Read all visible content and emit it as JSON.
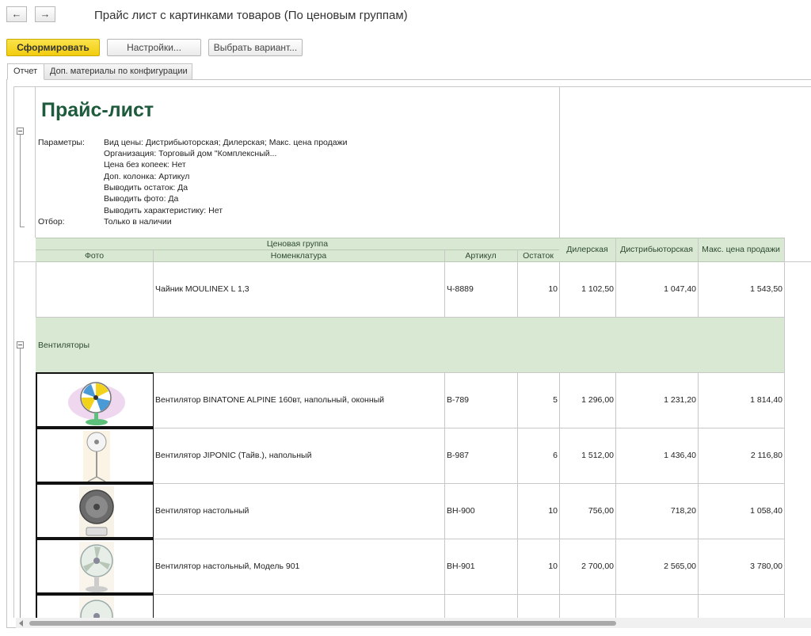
{
  "nav": {
    "back_icon": "←",
    "forward_icon": "→"
  },
  "window": {
    "title": "Прайс лист с картинками товаров (По ценовым группам)"
  },
  "toolbar": {
    "generate_label": "Сформировать",
    "settings_label": "Настройки...",
    "variant_label": "Выбрать вариант..."
  },
  "tabs": [
    {
      "label": "Отчет"
    },
    {
      "label": "Доп. материалы по конфигурации"
    }
  ],
  "report": {
    "heading": "Прайс-лист",
    "params_label": "Параметры:",
    "params": [
      "Вид цены: Дистрибьюторская; Дилерская; Макс. цена продажи",
      "Организация: Торговый дом \"Комплексный...",
      "Цена без копеек: Нет",
      "Доп. колонка: Артикул",
      "Выводить остаток: Да",
      "Выводить фото: Да",
      "Выводить характеристику: Нет"
    ],
    "filter_label": "Отбор:",
    "filter_value": "Только в наличии"
  },
  "table": {
    "group_header": "Ценовая группа",
    "columns": {
      "photo": "Фото",
      "name": "Номенклатура",
      "sku": "Артикул",
      "stock": "Остаток",
      "dealer": "Дилерская",
      "distributor": "Дистрибьюторская",
      "max_price": "Макс. цена продажи"
    },
    "first_row": {
      "name": "Чайник MOULINEX L 1,3",
      "sku": "Ч-8889",
      "stock": "10",
      "dealer": "1 102,50",
      "distributor": "1 047,40",
      "max_price": "1 543,50"
    },
    "group_name": "Вентиляторы",
    "rows": [
      {
        "name": "Вентилятор BINATONE ALPINE 160вт, напольный, оконный",
        "sku": "В-789",
        "stock": "5",
        "dealer": "1 296,00",
        "distributor": "1 231,20",
        "max_price": "1 814,40",
        "photo_icon": "colorful-fan-icon"
      },
      {
        "name": "Вентилятор JIPONIC (Тайв.), напольный",
        "sku": "В-987",
        "stock": "6",
        "dealer": "1 512,00",
        "distributor": "1 436,40",
        "max_price": "2 116,80",
        "photo_icon": "floor-fan-icon"
      },
      {
        "name": "Вентилятор настольный",
        "sku": "ВН-900",
        "stock": "10",
        "dealer": "756,00",
        "distributor": "718,20",
        "max_price": "1 058,40",
        "photo_icon": "desk-fan-dark-icon"
      },
      {
        "name": "Вентилятор настольный, Модель 901",
        "sku": "ВН-901",
        "stock": "10",
        "dealer": "2 700,00",
        "distributor": "2 565,00",
        "max_price": "3 780,00",
        "photo_icon": "desk-fan-icon"
      }
    ]
  },
  "colors": {
    "accent_button": "#f5d21a",
    "group_green": "#d8e8d2",
    "heading_green": "#1e5a3c"
  }
}
